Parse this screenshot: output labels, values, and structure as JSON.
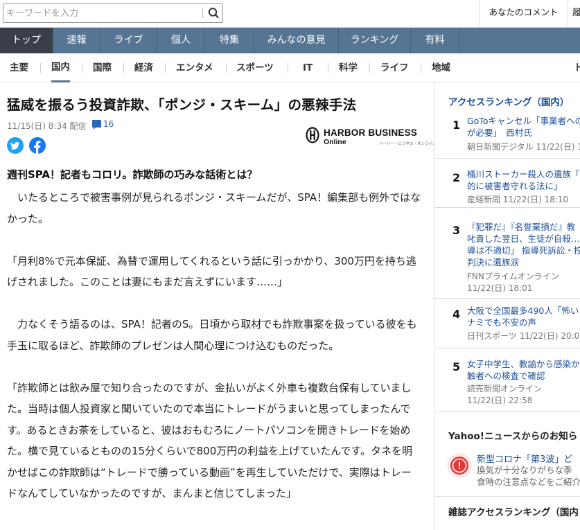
{
  "search": {
    "placeholder": "キーワードを入力"
  },
  "header_links": {
    "my_comments": "あなたのコメント",
    "more": "履"
  },
  "main_nav": [
    "トップ",
    "速報",
    "ライブ",
    "個人",
    "特集",
    "みんなの意見",
    "ランキング",
    "有料"
  ],
  "sub_nav": [
    "主要",
    "国内",
    "国際",
    "経済",
    "エンタメ",
    "スポーツ",
    "IT",
    "科学",
    "ライフ",
    "地域",
    "ト"
  ],
  "article": {
    "title": "猛威を振るう投資詐欺、「ポンジ・スキーム」の悪辣手法",
    "meta": "11/15(日) 8:34 配信",
    "comment_count": "16",
    "publisher": {
      "name_main": "HARBOR BUSINESS",
      "name_sub": "Online",
      "name_kana": "ハーバー・ビジネス・オンライン"
    },
    "subhead": "週刊SPA！記者もコロリ。詐欺師の巧みな話術とは？",
    "body": [
      "　いたるところで被害事例が見られるポンジ・スキームだが、SPA！編集部も例外ではなかった。",
      "「月利8%で元本保証、為替で運用してくれるという話に引っかかり、300万円を持ち逃げされました。このことは妻にもまだ言えずにいます……」",
      "　力なくそう語るのは、SPA！記者のS。日頃から取材でも詐欺事案を扱っている彼をも手玉に取るほど、詐欺師のプレゼンは人間心理につけ込むものだった。",
      "「詐欺師とは飲み屋で知り合ったのですが、金払いがよく外車も複数台保有していました。当時は個人投資家と聞いていたので本当にトレードがうまいと思ってしまったんです。あるときお茶をしていると、彼はおもむろにノートパソコンを開きトレードを始めた。横で見ているとものの15分くらいで800万円の利益を上げていたんです。タネを明かせばこの詐欺師は“トレードで勝っている動画”を再生していただけで、実際はトレードなんてしていなかったのですが、まんまと信じてしまった」"
    ]
  },
  "sidebar": {
    "access_ranking_title": "アクセスランキング（国内）",
    "ranking": [
      {
        "num": "1",
        "lines": [
          "GoToキャンセル「事業者への",
          "が必要」　西村氏"
        ],
        "source": "朝日新聞デジタル 11/22(日) 1",
        "time": ""
      },
      {
        "num": "2",
        "lines": [
          "桶川ストーカー殺人の遺族「",
          "的に被害者守れる法に」"
        ],
        "source": "産経新聞 11/22(日) 18:10",
        "time": ""
      },
      {
        "num": "3",
        "lines": [
          "『犯罪だ』『名誉棄損だ』教",
          "叱責した翌日、生徒が自殺…",
          "導は不適切」 指導死訴訟・控",
          "判決に遺族涙"
        ],
        "source": "FNNプライムオンライン",
        "time": "11/22(日) 18:01"
      },
      {
        "num": "4",
        "lines": [
          "大阪で全国最多490人「怖い",
          "ナミでも不安の声"
        ],
        "source": "日刊スポーツ 11/22(日) 20:0",
        "time": ""
      },
      {
        "num": "5",
        "lines": [
          "女子中学生、教諭から感染か",
          "触者への検査で確認"
        ],
        "source": "読売新聞オンライン",
        "time": "11/22(日) 22:58"
      }
    ],
    "news_notice_title": "Yahoo!ニュースからのお知ら",
    "notice": {
      "title": "新型コロナ「第3波」ど",
      "desc": [
        "換気が十分なりがちな季",
        "食時の注意点などをご紹介し"
      ]
    },
    "magazine_ranking_title": "雑誌アクセスランキング（国内"
  }
}
